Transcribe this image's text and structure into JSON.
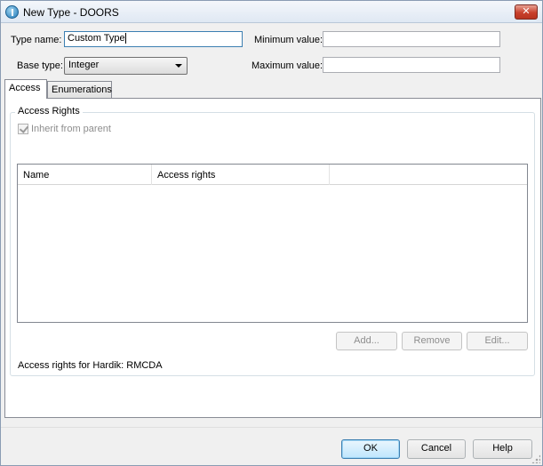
{
  "window": {
    "title": "New Type - DOORS",
    "close_label": "✕"
  },
  "form": {
    "type_name_label": "Type name:",
    "type_name_value": "Custom Type",
    "base_type_label": "Base type:",
    "base_type_value": "Integer",
    "minimum_value_label": "Minimum value:",
    "minimum_value_value": "",
    "maximum_value_label": "Maximum value:",
    "maximum_value_value": ""
  },
  "tabs": [
    {
      "label": "Access",
      "active": true
    },
    {
      "label": "Enumerations",
      "active": false
    }
  ],
  "access": {
    "group_title": "Access Rights",
    "inherit_label": "Inherit from parent",
    "inherit_checked": true,
    "columns": [
      "Name",
      "Access rights",
      ""
    ],
    "rows": [],
    "buttons": {
      "add": "Add...",
      "remove": "Remove",
      "edit": "Edit..."
    },
    "status": "Access rights for Hardik: RMCDA"
  },
  "footer": {
    "ok": "OK",
    "cancel": "Cancel",
    "help": "Help"
  }
}
